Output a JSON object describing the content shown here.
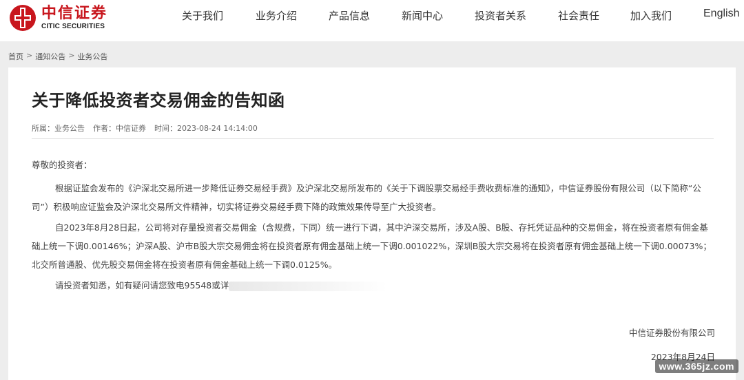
{
  "brand": {
    "name_cn": "中信证券",
    "name_en": "CITIC SECURITIES",
    "color": "#c8161d"
  },
  "nav": {
    "items": [
      {
        "label": "关于我们"
      },
      {
        "label": "业务介绍"
      },
      {
        "label": "产品信息"
      },
      {
        "label": "新闻中心"
      },
      {
        "label": "投资者关系"
      },
      {
        "label": "社会责任"
      },
      {
        "label": "加入我们"
      },
      {
        "label": "English"
      }
    ]
  },
  "breadcrumb": {
    "items": [
      "首页",
      "通知公告",
      "业务公告"
    ],
    "separator": ">"
  },
  "article": {
    "title": "关于降低投资者交易佣金的告知函",
    "meta": {
      "category": "所属：业务公告",
      "author": "作者：中信证券",
      "time": "时间：2023-08-24 14:14:00"
    },
    "greeting": "尊敬的投资者：",
    "paragraph1": "根据证监会发布的《沪深北交易所进一步降低证券交易经手费》及沪深北交易所发布的《关于下调股票交易经手费收费标准的通知》，中信证券股份有限公司（以下简称“公司”）积极响应证监会及沪深北交易所文件精神，切实将证券交易经手费下降的政策效果传导至广大投资者。",
    "paragraph2": "自2023年8月28日起，公司将对存量投资者交易佣金（含规费，下同）统一进行下调，其中沪深交易所，涉及A股、B股、存托凭证品种的交易佣金，将在投资者原有佣金基础上统一下调0.00146%；沪深A股、沪市B股大宗交易佣金将在投资者原有佣金基础上统一下调0.001022%，深圳B股大宗交易将在投资者原有佣金基础上统一下调0.00073%；北交所普通股、优先股交易佣金将在投资者原有佣金基础上统一下调0.0125%。",
    "paragraph3": "请投资者知悉，如有疑问请您致电95548或详",
    "signature_company": "中信证券股份有限公司",
    "signature_date": "2023年8月24日"
  },
  "watermark": "www.365jz.com"
}
